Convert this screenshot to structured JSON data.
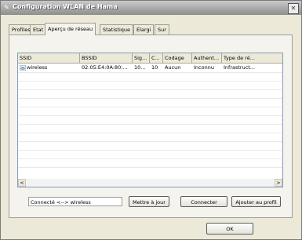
{
  "window": {
    "title": "Configuration WLAN de Hama",
    "close_label": "✕"
  },
  "tabs": [
    {
      "label": "Profiles"
    },
    {
      "label": "Etat"
    },
    {
      "label": "Aperçu de réseau"
    },
    {
      "label": "Statistique"
    },
    {
      "label": "Elargi"
    },
    {
      "label": "Sur"
    }
  ],
  "active_tab": "Aperçu de réseau",
  "network_list": {
    "columns": [
      "SSID",
      "BSSID",
      "Sig...",
      "C...",
      "Codage",
      "Authent...",
      "Type de ré..."
    ],
    "rows": [
      {
        "icon": "wireless-network-icon",
        "cells": [
          "wireless",
          "02:05:E4:0A:80:...",
          "10...",
          "10",
          "Aucun",
          "Inconnu",
          "Infrastruct..."
        ]
      }
    ]
  },
  "scrollbar": {
    "left_arrow": "<",
    "right_arrow": ">"
  },
  "status_text": "Connecté <--> wireless",
  "buttons": {
    "refresh": "Mettre à jour",
    "connect": "Connecter",
    "add_profile": "Ajouter au profil",
    "ok": "OK"
  }
}
